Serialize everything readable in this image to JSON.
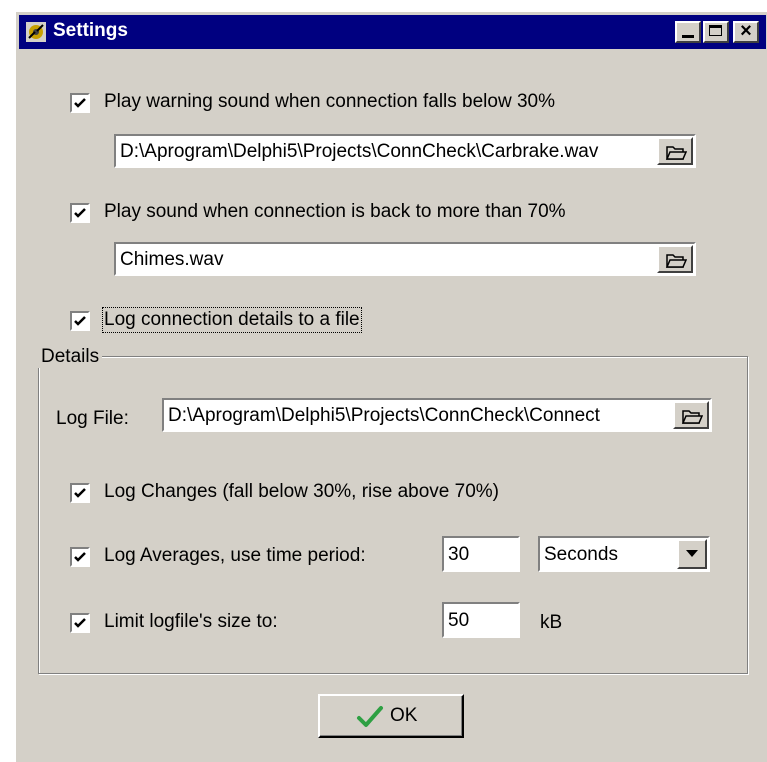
{
  "window": {
    "title": "Settings"
  },
  "options": {
    "warning_sound": {
      "label": "Play warning sound when connection falls below 30%",
      "checked": true,
      "file": "D:\\Aprogram\\Delphi5\\Projects\\ConnCheck\\Carbrake.wav"
    },
    "back_sound": {
      "label": "Play sound when connection is back to more than 70%",
      "checked": true,
      "file": "Chimes.wav"
    },
    "log_details": {
      "label": "Log connection details to a file",
      "checked": true
    }
  },
  "details": {
    "group_title": "Details",
    "log_file_label": "Log File:",
    "log_file_value": "D:\\Aprogram\\Delphi5\\Projects\\ConnCheck\\Connect",
    "log_changes": {
      "label": "Log Changes (fall below 30%, rise above 70%)",
      "checked": true
    },
    "log_averages": {
      "label": "Log Averages, use time period:",
      "checked": true,
      "value": "30",
      "unit": "Seconds"
    },
    "limit_size": {
      "label": "Limit logfile's size to:",
      "checked": true,
      "value": "50",
      "unit": "kB"
    }
  },
  "ok_button": {
    "label": "OK"
  },
  "icons": {
    "app": "app-icon",
    "browse": "folder-open-icon",
    "ok": "checkmark-icon"
  },
  "colors": {
    "titlebar": "#000080",
    "face": "#d4d0c8",
    "checkmark": "#2ea043"
  }
}
